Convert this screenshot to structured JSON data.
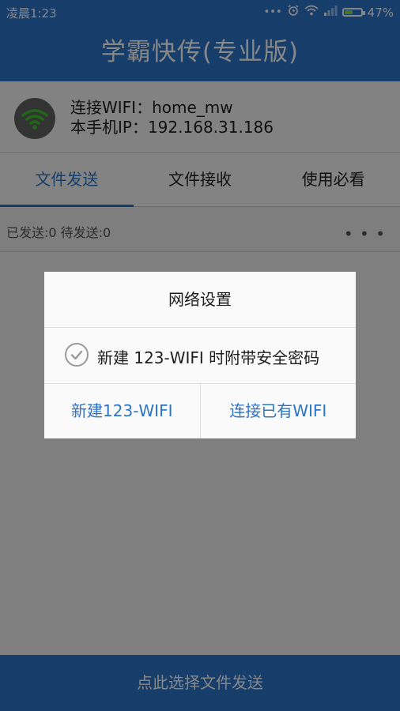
{
  "status_bar": {
    "time": "凌晨1:23",
    "battery_percent_label": "47%",
    "battery_level": 0.47,
    "icons": [
      "more-dots-icon",
      "alarm-icon",
      "wifi-icon",
      "signal-icon",
      "battery-icon"
    ]
  },
  "header": {
    "title": "学霸快传(专业版)"
  },
  "connection": {
    "wifi_line": "连接WIFI：home_mw",
    "ip_line": "本手机IP：192.168.31.186"
  },
  "tabs": [
    {
      "label": "文件发送",
      "active": true
    },
    {
      "label": "文件接收",
      "active": false
    },
    {
      "label": "使用必看",
      "active": false
    }
  ],
  "counts": {
    "text": "已发送:0  待发送:0"
  },
  "bottom_bar": {
    "label": "点此选择文件发送"
  },
  "dialog": {
    "title": "网络设置",
    "option_label": "新建 123-WIFI 时附带安全密码",
    "option_checked": true,
    "buttons": [
      {
        "label": "新建123-WIFI"
      },
      {
        "label": "连接已有WIFI"
      }
    ]
  },
  "colors": {
    "primary": "#2c74c9",
    "wifi_green": "#3cc42e"
  }
}
